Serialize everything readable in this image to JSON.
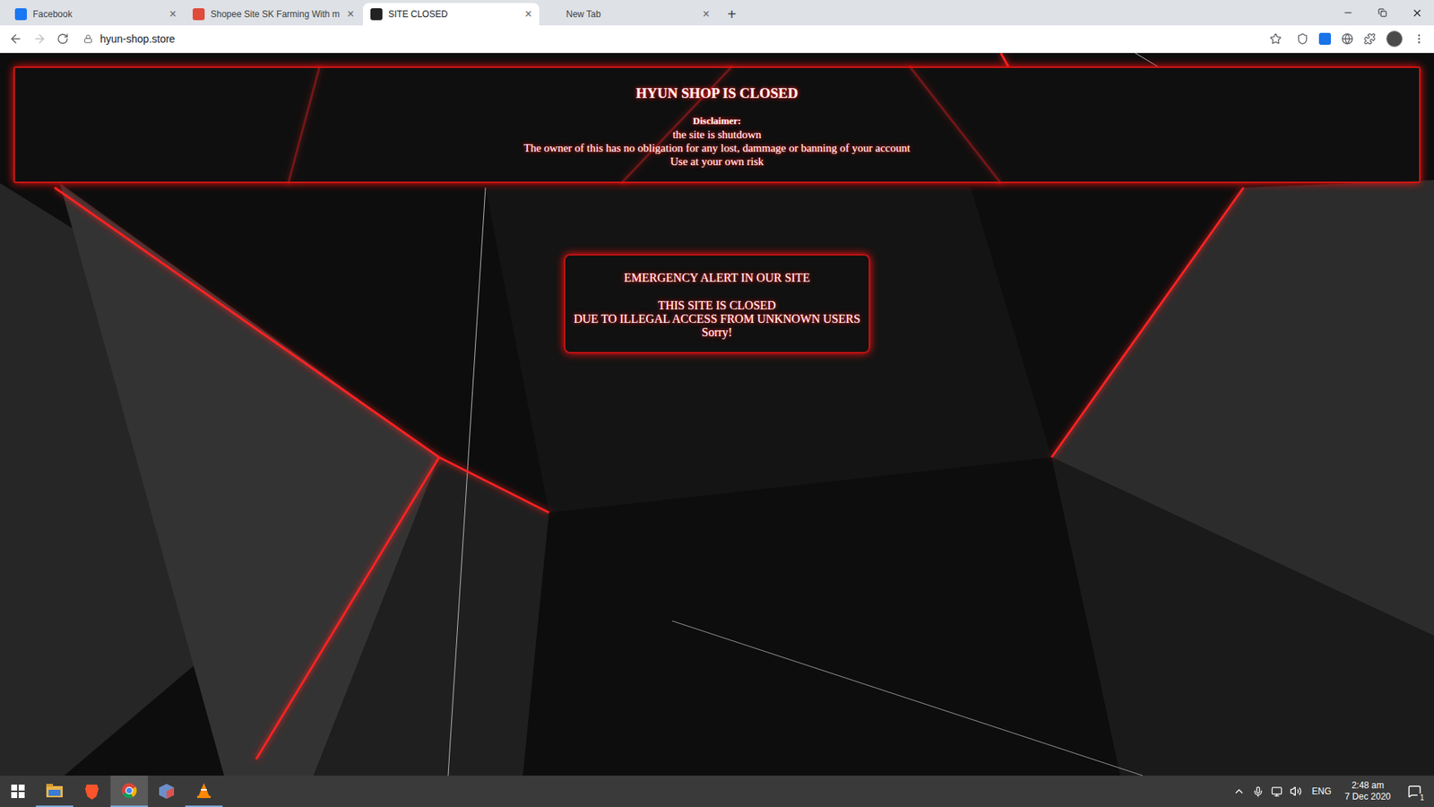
{
  "browser": {
    "tabs": [
      {
        "label": "Facebook",
        "selected": false,
        "color": "#1877f2"
      },
      {
        "label": "Shopee Site SK Farming With m",
        "selected": false,
        "color": "#e04b3a"
      },
      {
        "label": "SITE CLOSED",
        "selected": true,
        "color": "#222222"
      },
      {
        "label": "New Tab",
        "selected": false,
        "color": "#dee1e6"
      }
    ],
    "close_glyph": "×",
    "new_tab": "+",
    "address": "hyun-shop.store"
  },
  "page": {
    "header": {
      "title": "HYUN SHOP IS CLOSED",
      "disclaimer_label": "Disclaimer:",
      "lines": [
        "the site is shutdown",
        "The owner of this has no obligation for any lost, dammage or banning of your account",
        "Use at your own risk"
      ]
    },
    "alert": {
      "title": "EMERGENCY ALERT IN OUR SITE",
      "lines": [
        "THIS SITE IS CLOSED",
        "DUE TO ILLEGAL ACCESS FROM UNKNOWN USERS",
        "Sorry!"
      ]
    }
  },
  "taskbar": {
    "language": "ENG",
    "time": "2:48 am",
    "date": "7 Dec 2020",
    "notifications": "1"
  }
}
